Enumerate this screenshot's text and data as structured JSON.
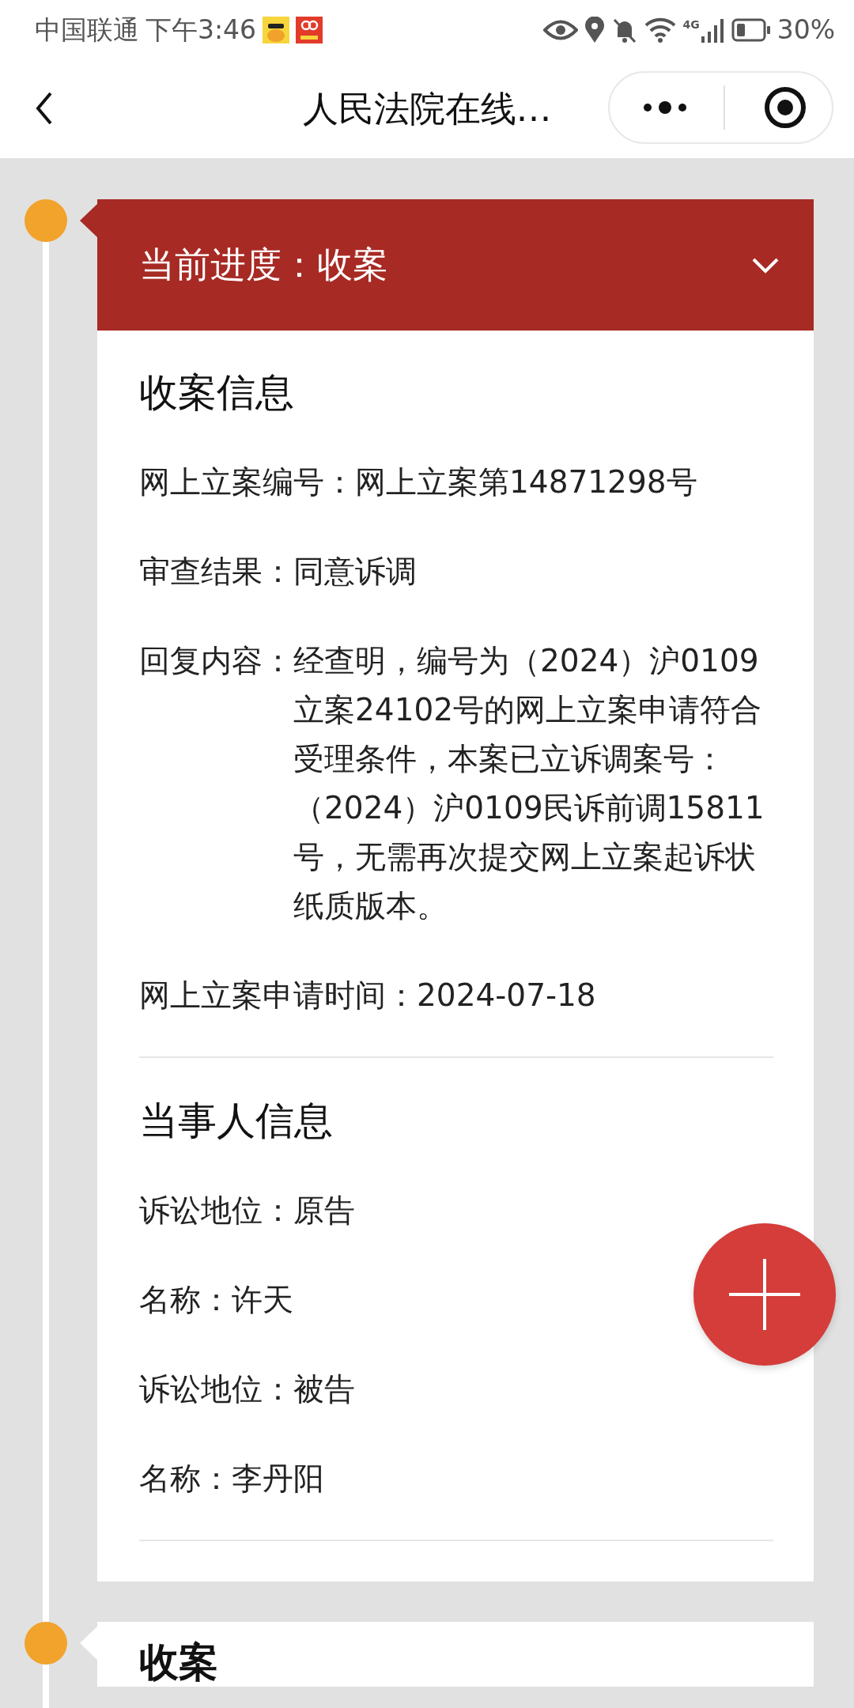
{
  "status_bar": {
    "carrier": "中国联通",
    "time": "下午3:46",
    "network": "4G",
    "battery": "30%"
  },
  "nav": {
    "title": "人民法院在线…"
  },
  "timeline": [
    {
      "kind": "progress",
      "header_label": "当前进度：",
      "stage": "收案",
      "expanded": true,
      "sections": [
        {
          "title": "收案信息",
          "fields": [
            {
              "label": "网上立案编号：",
              "value": "网上立案第14871298号"
            },
            {
              "label": "审查结果：",
              "value": "同意诉调"
            },
            {
              "label": "回复内容：",
              "value": "经查明，编号为（2024）沪0109立案24102号的网上立案申请符合受理条件，本案已立诉调案号：（2024）沪0109民诉前调15811号，无需再次提交网上立案起诉状纸质版本。"
            },
            {
              "label": "网上立案申请时间：",
              "value": "2024-07-18"
            }
          ]
        },
        {
          "title": "当事人信息",
          "fields": [
            {
              "label": "诉讼地位：",
              "value": "原告"
            },
            {
              "label": "名称：",
              "value": "许天"
            },
            {
              "label": "诉讼地位：",
              "value": "被告"
            },
            {
              "label": "名称：",
              "value": "李丹阳"
            }
          ]
        }
      ]
    },
    {
      "kind": "step",
      "title": "收案"
    }
  ]
}
